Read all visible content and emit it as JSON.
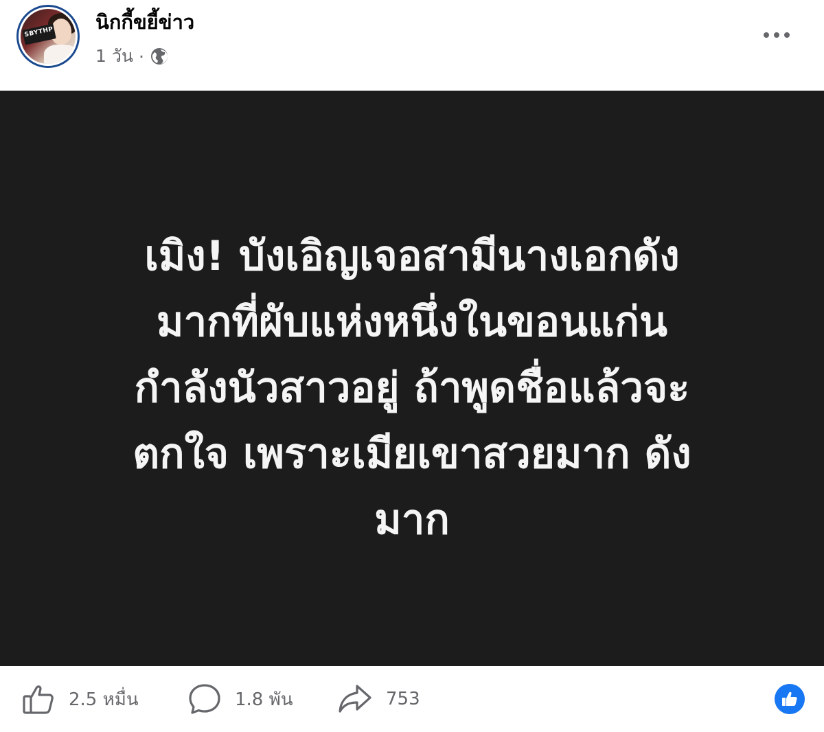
{
  "header": {
    "page_name": "นิกกี้ขยี้ข่าว",
    "time": "1 วัน",
    "separator": "·",
    "audience_icon": "globe-icon",
    "more_icon": "more-horizontal-icon",
    "avatar_logo_text": "SBYTHP"
  },
  "post": {
    "background_color": "#1c1c1c",
    "text_color": "#f5f5f5",
    "lines": [
      "เมิง! บังเอิญเจอสามีนางเอกดัง",
      "มากที่ผับแห่งหนึ่งในขอนแก่น",
      "กำลังนัวสาวอยู่ ถ้าพูดชื่อแล้วจะ",
      "ตกใจ เพราะเมียเขาสวยมาก ดัง",
      "มาก"
    ]
  },
  "footer": {
    "reactions": {
      "icon": "thumbs-up-icon",
      "count": "2.5 หมื่น"
    },
    "comments": {
      "icon": "comment-icon",
      "count": "1.8 พัน"
    },
    "shares": {
      "icon": "share-icon",
      "count": "753"
    },
    "like_badge_icon": "like-badge-icon",
    "accent_color": "#1877f2"
  }
}
